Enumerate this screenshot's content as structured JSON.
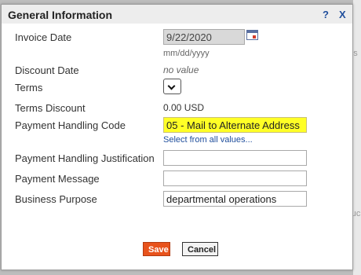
{
  "background": {
    "text1": "aps",
    "text2": "Chruc",
    "text3": "Tiri"
  },
  "dialog": {
    "title": "General Information",
    "help_label": "?",
    "close_label": "X"
  },
  "fields": {
    "invoice_date": {
      "label": "Invoice Date",
      "value": "9/22/2020",
      "hint": "mm/dd/yyyy"
    },
    "discount_date": {
      "label": "Discount Date",
      "value": "no value"
    },
    "terms": {
      "label": "Terms",
      "value": ""
    },
    "terms_discount": {
      "label": "Terms Discount",
      "value": "0.00 USD"
    },
    "payment_handling_code": {
      "label": "Payment Handling Code",
      "value": "05 - Mail to Alternate Address",
      "link": "Select from all values..."
    },
    "payment_handling_justification": {
      "label": "Payment Handling Justification",
      "value": ""
    },
    "payment_message": {
      "label": "Payment Message",
      "value": ""
    },
    "business_purpose": {
      "label": "Business Purpose",
      "value": "departmental operations"
    }
  },
  "buttons": {
    "save_label": "Save",
    "cancel_label": "Cancel"
  },
  "colors": {
    "save_button": "#e8531c",
    "highlight": "#ffff26",
    "link": "#1f4e9c"
  }
}
